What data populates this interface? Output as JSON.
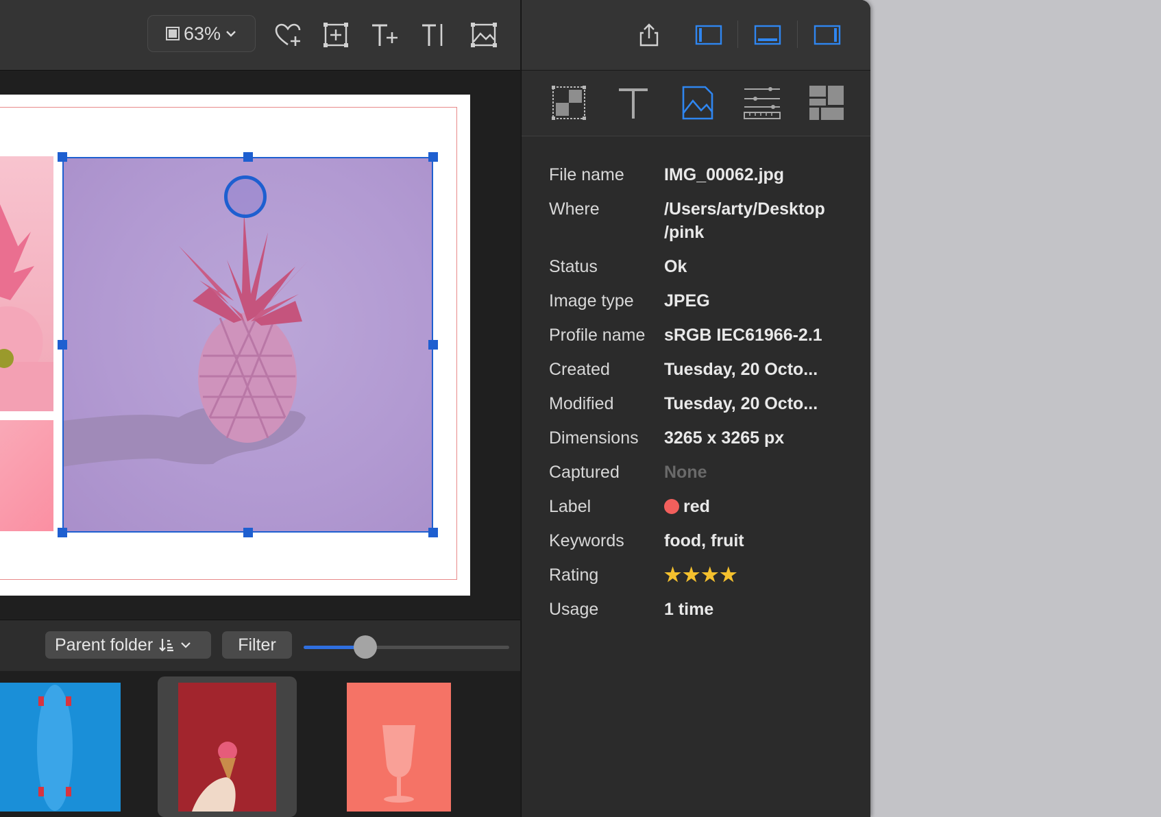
{
  "toolbar": {
    "zoom_label": "63%"
  },
  "bottom_bar": {
    "sort_label": "Parent folder",
    "filter_label": "Filter",
    "thumb_size_level": 0.3
  },
  "info": {
    "rows": [
      {
        "key": "File name",
        "value": "IMG_00062.jpg"
      },
      {
        "key": "Where",
        "value": "/Users/arty/Desktop /pink"
      },
      {
        "key": "Status",
        "value": "Ok"
      },
      {
        "key": "Image type",
        "value": "JPEG"
      },
      {
        "key": "Profile name",
        "value": "sRGB IEC61966-2.1"
      },
      {
        "key": "Created",
        "value": "Tuesday, 20 Octo..."
      },
      {
        "key": "Modified",
        "value": "Tuesday, 20 Octo..."
      },
      {
        "key": "Dimensions",
        "value": "3265 x 3265 px"
      },
      {
        "key": "Captured",
        "value": "None"
      },
      {
        "key": "Label",
        "value": "red"
      },
      {
        "key": "Keywords",
        "value": "food, fruit"
      },
      {
        "key": "Rating",
        "value": "★★★★"
      },
      {
        "key": "Usage",
        "value": "1 time"
      }
    ],
    "label_color": "#f25f5c",
    "rating": 4
  },
  "colors": {
    "accent": "#1e5fd0",
    "panel": "#2b2b2b"
  }
}
